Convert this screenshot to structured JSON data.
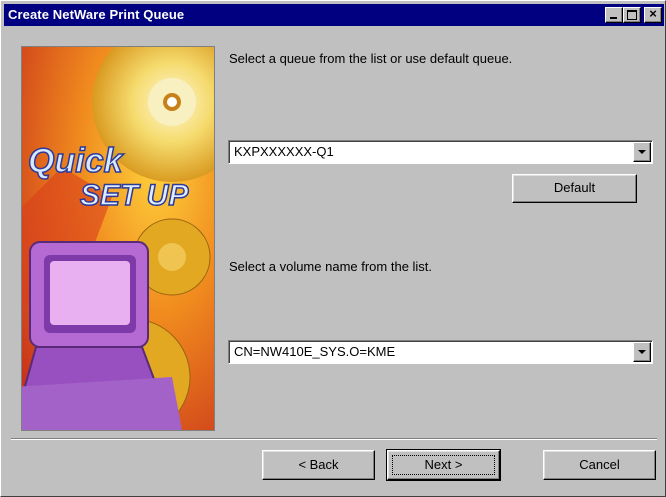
{
  "window": {
    "title": "Create NetWare Print Queue"
  },
  "banner": {
    "line1": "Quick",
    "line2": "SET UP"
  },
  "queue": {
    "prompt": "Select a queue from the list or use default queue.",
    "selected": "KXPXXXXXX-Q1",
    "default_label": "Default"
  },
  "volume": {
    "prompt": "Select a volume name from the list.",
    "selected": "CN=NW410E_SYS.O=KME"
  },
  "footer": {
    "back_label": "< Back",
    "next_label": "Next >",
    "cancel_label": "Cancel"
  }
}
